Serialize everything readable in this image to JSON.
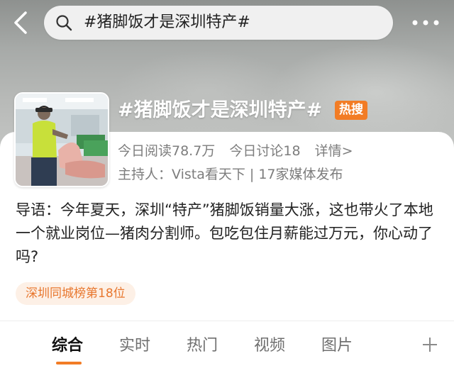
{
  "header": {
    "search_query": "#猪脚饭才是深圳特产#",
    "back_icon": "chevron-left-icon",
    "search_icon": "search-icon",
    "more_icon": "more-horizontal-icon"
  },
  "topic": {
    "title": "#猪脚饭才是深圳特产#",
    "badge": "热搜",
    "badge_color": "#f27c25",
    "stats": {
      "reads": "今日阅读78.7万",
      "discussions": "今日讨论18",
      "details": "详情>"
    },
    "host": "主持人：Vista看天下 | 17家媒体发布",
    "intro": "导语：今年夏天，深圳“特产”猪脚饭销量大涨，这也带火了本地一个就业岗位—猪肉分割师。包吃包住月薪能过万元，你心动了吗?",
    "rank": "深圳同城榜第18位"
  },
  "tabs": [
    {
      "label": "综合",
      "active": true
    },
    {
      "label": "实时",
      "active": false
    },
    {
      "label": "热门",
      "active": false
    },
    {
      "label": "视频",
      "active": false
    },
    {
      "label": "图片",
      "active": false
    }
  ],
  "add_tab_icon": "plus-icon",
  "accent_color": "#f27c25"
}
